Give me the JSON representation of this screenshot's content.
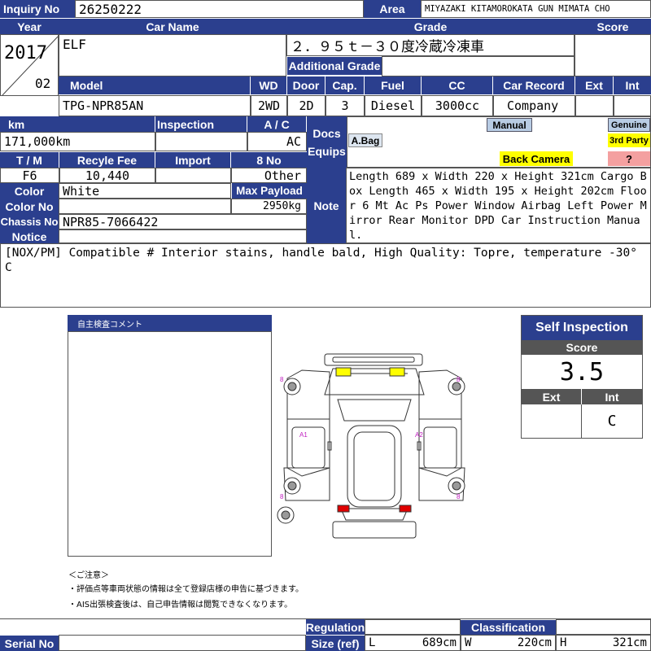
{
  "inquiry": {
    "label": "Inquiry No",
    "value": "26250222"
  },
  "area": {
    "label": "Area",
    "value": "MIYAZAKI KITAMOROKATA GUN MIMATA CHO"
  },
  "headers": {
    "year": "Year",
    "car_name": "Car Name",
    "grade": "Grade",
    "score": "Score",
    "additional_grade": "Additional Grade"
  },
  "year": {
    "value": "2017",
    "month": "02"
  },
  "car_name": "ELF",
  "grade": "２．９５ｔ－３０度冷蔵冷凍車",
  "spec_headers": {
    "model": "Model",
    "wd": "WD",
    "door": "Door",
    "cap": "Cap.",
    "fuel": "Fuel",
    "cc": "CC",
    "car_record": "Car Record",
    "ext": "Ext",
    "int": "Int"
  },
  "spec": {
    "model": "TPG-NPR85AN",
    "wd": "2WD",
    "door": "2D",
    "cap": "3",
    "fuel": "Diesel",
    "cc": "3000cc",
    "car_record": "Company"
  },
  "labels": {
    "km": "km",
    "inspection": "Inspection",
    "ac": "A / C",
    "docs": "Docs",
    "equips": "Equips",
    "tm": "T / M",
    "recycle_fee": "Recyle Fee",
    "import": "Import",
    "no8": "8 No",
    "color": "Color",
    "max_payload": "Max Payload",
    "color_no": "Color No",
    "chassis_no": "Chassis No",
    "notice": "Notice",
    "note": "Note"
  },
  "values": {
    "km": "171,000km",
    "ac": "AC",
    "tm": "F6",
    "recycle_fee": "10,440",
    "no8": "Other",
    "color": "White",
    "max_payload": "2950kg",
    "chassis_no": "NPR85-7066422"
  },
  "equips": {
    "manual": "Manual",
    "genuine": "Genuine",
    "third_party": "3rd Party",
    "abag": "A.Bag",
    "back_camera": "Back Camera",
    "unknown": "?"
  },
  "note": "Length 689 x Width 220 x Height 321cm Cargo Box Length 465 x Width 195 x Height 202cm Floor 6 Mt Ac Ps Power Window Airbag Left Power Mirror Rear Monitor DPD Car Instruction Manual.",
  "notice": "[NOX/PM] Compatible # Interior stains, handle bald, High Quality: Topre, temperature -30° C",
  "comment_box": {
    "title": "自主検査コメント"
  },
  "self_inspection": {
    "title": "Self Inspection",
    "score_label": "Score",
    "score": "3.5",
    "ext_label": "Ext",
    "int_label": "Int",
    "ext": "",
    "int": "C"
  },
  "diagram_marks": {
    "a1": "A1",
    "a2": "A2",
    "m8": "8"
  },
  "caution": {
    "title": "＜ご注意＞",
    "line1": "・評価点等車両状態の情報は全て登録店様の申告に基づきます。",
    "line2": "・AIS出張検査後は、自己申告情報は閲覧できなくなります。"
  },
  "footer": {
    "serial_no": "Serial No",
    "regulation": "Regulation",
    "size_ref": "Size (ref)",
    "classification": "Classification",
    "l_label": "L",
    "l_value": "689cm",
    "w_label": "W",
    "w_value": "220cm",
    "h_label": "H",
    "h_value": "321cm"
  },
  "colors": {
    "header_blue": "#2b3f8e",
    "manual_bg": "#b8cce4",
    "genuine_bg": "#b8cce4",
    "third_party_bg": "#ffff00",
    "back_camera_bg": "#ffff00",
    "unknown_bg": "#f4a0a0",
    "abag_bg": "#dde6f0"
  }
}
